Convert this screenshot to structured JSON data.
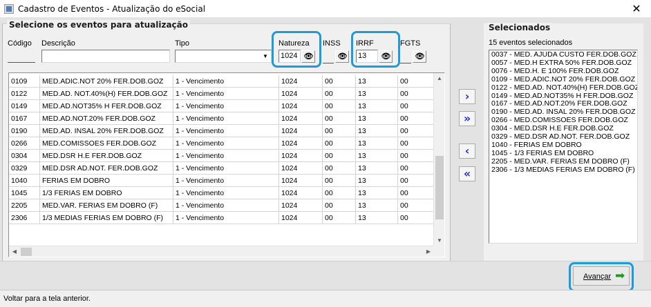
{
  "window": {
    "title": "Cadastro de Eventos - Atualização do eSocial",
    "close_glyph": "✕"
  },
  "left": {
    "title": "Selecione os eventos para atualização",
    "filters": {
      "codigo_label": "Código",
      "codigo_value": "",
      "descricao_label": "Descrição",
      "descricao_value": "",
      "tipo_label": "Tipo",
      "tipo_value": "",
      "natureza_label": "Natureza",
      "natureza_value": "1024",
      "inss_label": "INSS",
      "inss_value": "",
      "irrf_label": "IRRF",
      "irrf_value": "13",
      "fgts_label": "FGTS",
      "fgts_value": ""
    },
    "rows": [
      [
        "0109",
        "MED.ADIC.NOT 20%  FER.DOB.GOZ",
        "1 - Vencimento",
        "1024",
        "00",
        "13",
        "00"
      ],
      [
        "0122",
        "MED.AD. NOT.40%(H) FER.DOB.GOZ",
        "1 - Vencimento",
        "1024",
        "00",
        "13",
        "00"
      ],
      [
        "0149",
        "MED.AD.NOT35% H FER.DOB.GOZ",
        "1 - Vencimento",
        "1024",
        "00",
        "13",
        "00"
      ],
      [
        "0167",
        "MED.AD.NOT.20%  FER.DOB.GOZ",
        "1 - Vencimento",
        "1024",
        "00",
        "13",
        "00"
      ],
      [
        "0190",
        "MED.AD. INSAL 20% FER.DOB.GOZ",
        "1 - Vencimento",
        "1024",
        "00",
        "13",
        "00"
      ],
      [
        "0266",
        "MED.COMISSOES  FER.DOB.GOZ",
        "1 - Vencimento",
        "1024",
        "00",
        "13",
        "00"
      ],
      [
        "0304",
        "MED.DSR H.E  FER.DOB.GOZ",
        "1 - Vencimento",
        "1024",
        "00",
        "13",
        "00"
      ],
      [
        "0329",
        "MED.DSR AD.NOT. FER.DOB.GOZ",
        "1 - Vencimento",
        "1024",
        "00",
        "13",
        "00"
      ],
      [
        "1040",
        "FERIAS EM DOBRO",
        "1 - Vencimento",
        "1024",
        "00",
        "13",
        "00"
      ],
      [
        "1045",
        "1/3 FERIAS EM DOBRO",
        "1 - Vencimento",
        "1024",
        "00",
        "13",
        "00"
      ],
      [
        "2205",
        "MED.VAR. FERIAS EM DOBRO (F)",
        "1 - Vencimento",
        "1024",
        "00",
        "13",
        "00"
      ],
      [
        "2306",
        "1/3 MEDIAS FERIAS EM DOBRO (F)",
        "1 - Vencimento",
        "1024",
        "00",
        "13",
        "00"
      ]
    ]
  },
  "buttons": {
    "add_one": "›",
    "add_all": "»",
    "remove_one": "‹",
    "remove_all": "«",
    "advance": "Avançar",
    "advance_arrow": "➡"
  },
  "right": {
    "title": "Selecionados",
    "count": "15 eventos selecionados",
    "items": [
      "0037 - MED. AJUDA CUSTO FER.DOB.GOZ",
      "0057 - MED.H EXTRA 50%  FER.DOB.GOZ",
      "0076 - MED.H. E 100% FER.DOB.GOZ",
      "0109 - MED.ADIC.NOT 20%  FER.DOB.GOZ",
      "0122 - MED.AD. NOT.40%(H) FER.DOB.GOZ",
      "0149 - MED.AD.NOT35% H FER.DOB.GOZ",
      "0167 - MED.AD.NOT.20%  FER.DOB.GOZ",
      "0190 - MED.AD. INSAL 20% FER.DOB.GOZ",
      "0266 - MED.COMISSOES  FER.DOB.GOZ",
      "0304 - MED.DSR H.E  FER.DOB.GOZ",
      "0329 - MED.DSR AD.NOT. FER.DOB.GOZ",
      "1040 - FERIAS EM DOBRO",
      "1045 - 1/3 FERIAS EM DOBRO",
      "2205 - MED.VAR. FERIAS EM DOBRO (F)",
      "2306 - 1/3 MEDIAS FERIAS EM DOBRO (F)"
    ]
  },
  "status": "Voltar para a tela anterior.",
  "colors": {
    "highlight": "#1c9bd8",
    "move_arrows": "#2b2bd0",
    "advance_arrow": "#1c9b1c"
  }
}
